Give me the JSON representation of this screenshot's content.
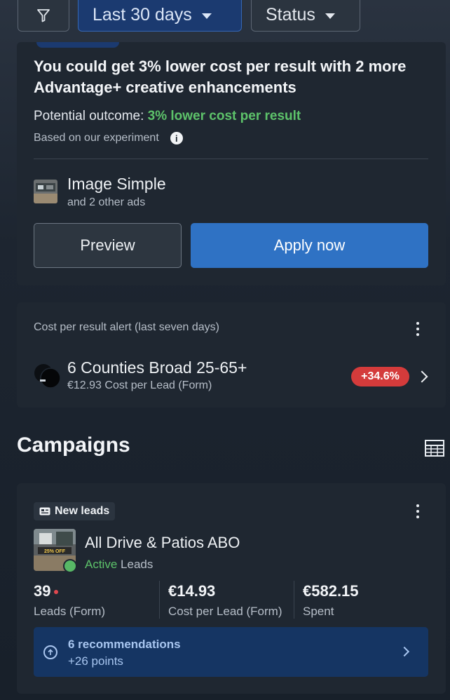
{
  "toolbar": {
    "filter_icon": "filter-icon",
    "date_range": "Last 30 days",
    "status_label": "Status"
  },
  "recommendation_card": {
    "headline": "You could get 3% lower cost per result with 2 more Advantage+ creative enhancements",
    "outcome_prefix": "Potential outcome: ",
    "outcome_value": "3% lower cost per result",
    "basis": "Based on our experiment",
    "ad_name": "Image Simple",
    "ad_others": "and 2 other ads",
    "preview_label": "Preview",
    "apply_label": "Apply now",
    "outcome_color": "#5dc26a"
  },
  "alert_card": {
    "title": "Cost per result alert (last seven days)",
    "campaign_name": "6 Counties Broad 25-65+",
    "cost_line": "€12.93 Cost per Lead (Form)",
    "change_badge": "+34.6%",
    "badge_color": "#d43b3b"
  },
  "campaigns": {
    "section_title": "Campaigns",
    "card": {
      "objective_tag": "New leads",
      "name": "All Drive & Patios ABO",
      "status": "Active",
      "type": "Leads",
      "thumbnail_text": "25% OFF",
      "metrics": [
        {
          "value": "39",
          "label": "Leads (Form)"
        },
        {
          "value": "€14.93",
          "label": "Cost per Lead (Form)"
        },
        {
          "value": "€582.15",
          "label": "Spent"
        }
      ],
      "recommendations_title": "6 recommendations",
      "recommendations_points": "+26 points"
    }
  },
  "colors": {
    "accent_blue": "#2f72c4",
    "date_pill": "#1b3a70",
    "card_bg": "#1f2731"
  }
}
